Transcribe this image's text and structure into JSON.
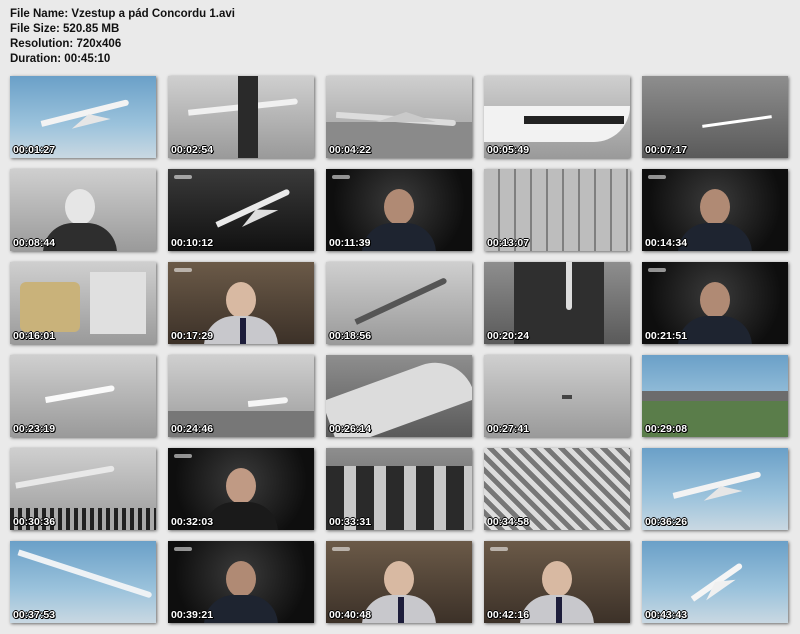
{
  "file_info": {
    "file_name": "File Name: Vzestup a pád Concordu 1.avi",
    "file_size": "File Size: 520.85 MB",
    "resolution": "Resolution: 720x406",
    "duration": "Duration: 00:45:10"
  },
  "thumbnails": [
    {
      "time": "00:01:27",
      "scene": "sky",
      "subject": "concorde-in-flight"
    },
    {
      "time": "00:02:54",
      "scene": "bw-light",
      "subject": "model-in-hands"
    },
    {
      "time": "00:04:22",
      "scene": "bw-light",
      "subject": "airfield-aircraft"
    },
    {
      "time": "00:05:49",
      "scene": "bw-light",
      "subject": "pan-am-fuselage"
    },
    {
      "time": "00:07:17",
      "scene": "bw-mid",
      "subject": "streak-in-sky"
    },
    {
      "time": "00:08:44",
      "scene": "bw-light",
      "subject": "portrait-man"
    },
    {
      "time": "00:10:12",
      "scene": "bw-dark",
      "subject": "model-display"
    },
    {
      "time": "00:11:39",
      "scene": "dark-room",
      "subject": "interview-man"
    },
    {
      "time": "00:13:07",
      "scene": "bw-light",
      "subject": "aviation-building"
    },
    {
      "time": "00:14:34",
      "scene": "dark-room",
      "subject": "interview-man"
    },
    {
      "time": "00:16:01",
      "scene": "bw-light",
      "subject": "engine-workshop"
    },
    {
      "time": "00:17:29",
      "scene": "office",
      "subject": "interview-elder"
    },
    {
      "time": "00:18:56",
      "scene": "bw-light",
      "subject": "technical-drawing"
    },
    {
      "time": "00:20:24",
      "scene": "bw-mid",
      "subject": "hangar"
    },
    {
      "time": "00:21:51",
      "scene": "dark-room",
      "subject": "interview-man"
    },
    {
      "time": "00:23:19",
      "scene": "bw-light",
      "subject": "plane-takeoff"
    },
    {
      "time": "00:24:46",
      "scene": "bw-light",
      "subject": "plane-landing"
    },
    {
      "time": "00:26:14",
      "scene": "bw-mid",
      "subject": "plane-closeup"
    },
    {
      "time": "00:27:41",
      "scene": "bw-light",
      "subject": "distant-plane"
    },
    {
      "time": "00:29:08",
      "scene": "sky",
      "subject": "airshow-field"
    },
    {
      "time": "00:30:36",
      "scene": "bw-light",
      "subject": "crowd-and-plane"
    },
    {
      "time": "00:32:03",
      "scene": "dark-room",
      "subject": "interview-bald"
    },
    {
      "time": "00:33:31",
      "scene": "bw-mid",
      "subject": "men-in-suits"
    },
    {
      "time": "00:34:58",
      "scene": "bw-mid",
      "subject": "crowd-stands"
    },
    {
      "time": "00:36:26",
      "scene": "sky",
      "subject": "concorde-in-flight"
    },
    {
      "time": "00:37:53",
      "scene": "sky",
      "subject": "concorde-nose"
    },
    {
      "time": "00:39:21",
      "scene": "dark-room",
      "subject": "interview-man"
    },
    {
      "time": "00:40:48",
      "scene": "office",
      "subject": "interview-elder"
    },
    {
      "time": "00:42:16",
      "scene": "office",
      "subject": "interview-elder"
    },
    {
      "time": "00:43:43",
      "scene": "sky",
      "subject": "concorde-overhead"
    }
  ]
}
